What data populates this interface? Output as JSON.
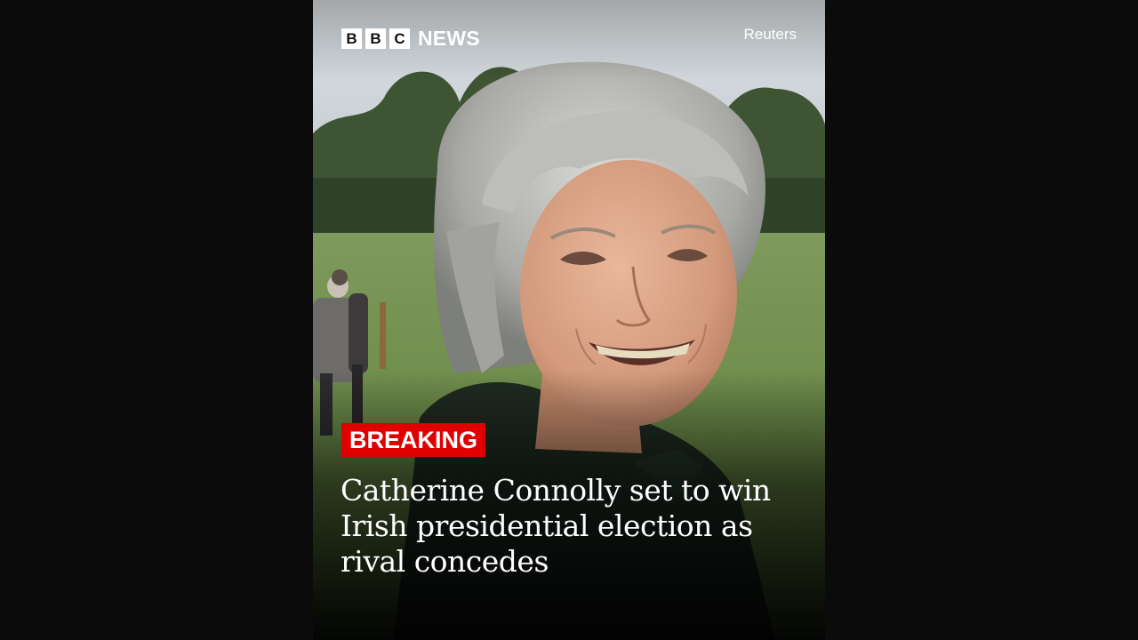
{
  "brand": {
    "letters": [
      "B",
      "B",
      "C"
    ],
    "name": "NEWS"
  },
  "photo_credit": "Reuters",
  "label": "BREAKING",
  "headline": "Catherine Connolly set to win Irish presidential election as rival concedes",
  "colors": {
    "page_background": "#0b0b0b",
    "breaking_red": "#e00000",
    "text": "#ffffff"
  }
}
